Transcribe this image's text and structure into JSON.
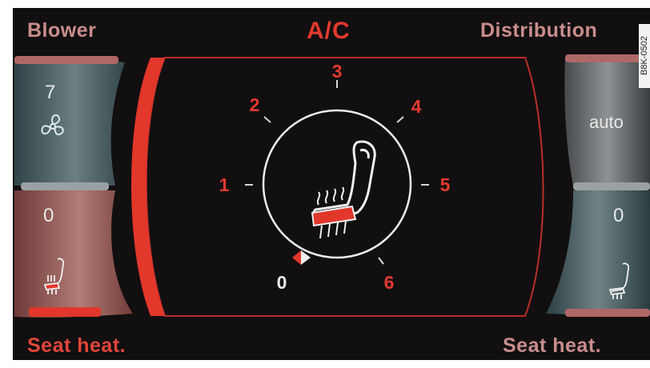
{
  "header": {
    "blower_label": "Blower",
    "ac_label": "A/C",
    "distribution_label": "Distribution"
  },
  "footer": {
    "seat_heat_left_label": "Seat heat.",
    "seat_heat_right_label": "Seat heat."
  },
  "left_panel": {
    "blower_value": "7",
    "blower_icon": "fan-icon",
    "seat_heat_value": "0",
    "seat_heat_icon": "heated-seat-icon"
  },
  "right_panel": {
    "distribution_value": "auto",
    "seat_heat_value": "0",
    "seat_heat_icon": "heated-seat-icon"
  },
  "dial": {
    "scale": [
      "0",
      "1",
      "2",
      "3",
      "4",
      "5",
      "6"
    ],
    "current_level": "0",
    "center_icon": "heated-seat-icon"
  },
  "watermark": "B8K-0502",
  "colors": {
    "accent_red": "#e23a2f",
    "label_pink": "#c98d8c",
    "background": "#120f10"
  }
}
